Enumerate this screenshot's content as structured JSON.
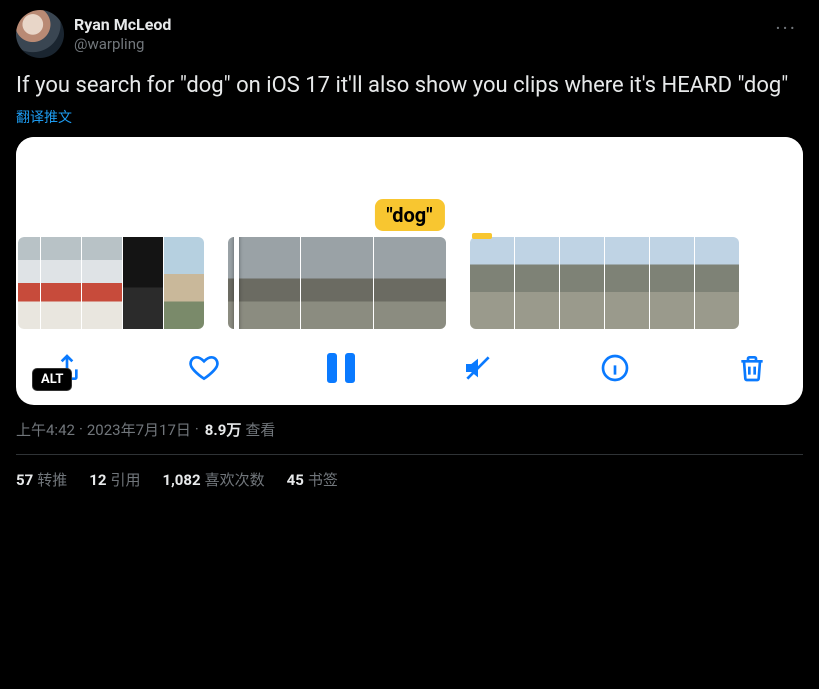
{
  "author": {
    "display_name": "Ryan McLeod",
    "handle": "@warpling"
  },
  "body": "If you search for \"dog\" on iOS 17 it'll also show you clips where it's HEARD \"dog\"",
  "translate_label": "翻译推文",
  "media": {
    "caption_bubble": "\"dog\"",
    "alt_badge": "ALT",
    "toolbar_icons": {
      "share": "share-icon",
      "like": "heart-icon",
      "pause": "pause-icon",
      "mute": "mute-icon",
      "info": "info-icon",
      "delete": "trash-icon"
    }
  },
  "meta": {
    "time": "上午4:42",
    "dot1": " · ",
    "date": "2023年7月17日",
    "dot2": " · ",
    "views_count": "8.9万",
    "views_label": " 查看"
  },
  "stats": {
    "retweets": {
      "count": "57",
      "label": "转推"
    },
    "quotes": {
      "count": "12",
      "label": "引用"
    },
    "likes": {
      "count": "1,082",
      "label": "喜欢次数"
    },
    "bookmarks": {
      "count": "45",
      "label": "书签"
    }
  }
}
